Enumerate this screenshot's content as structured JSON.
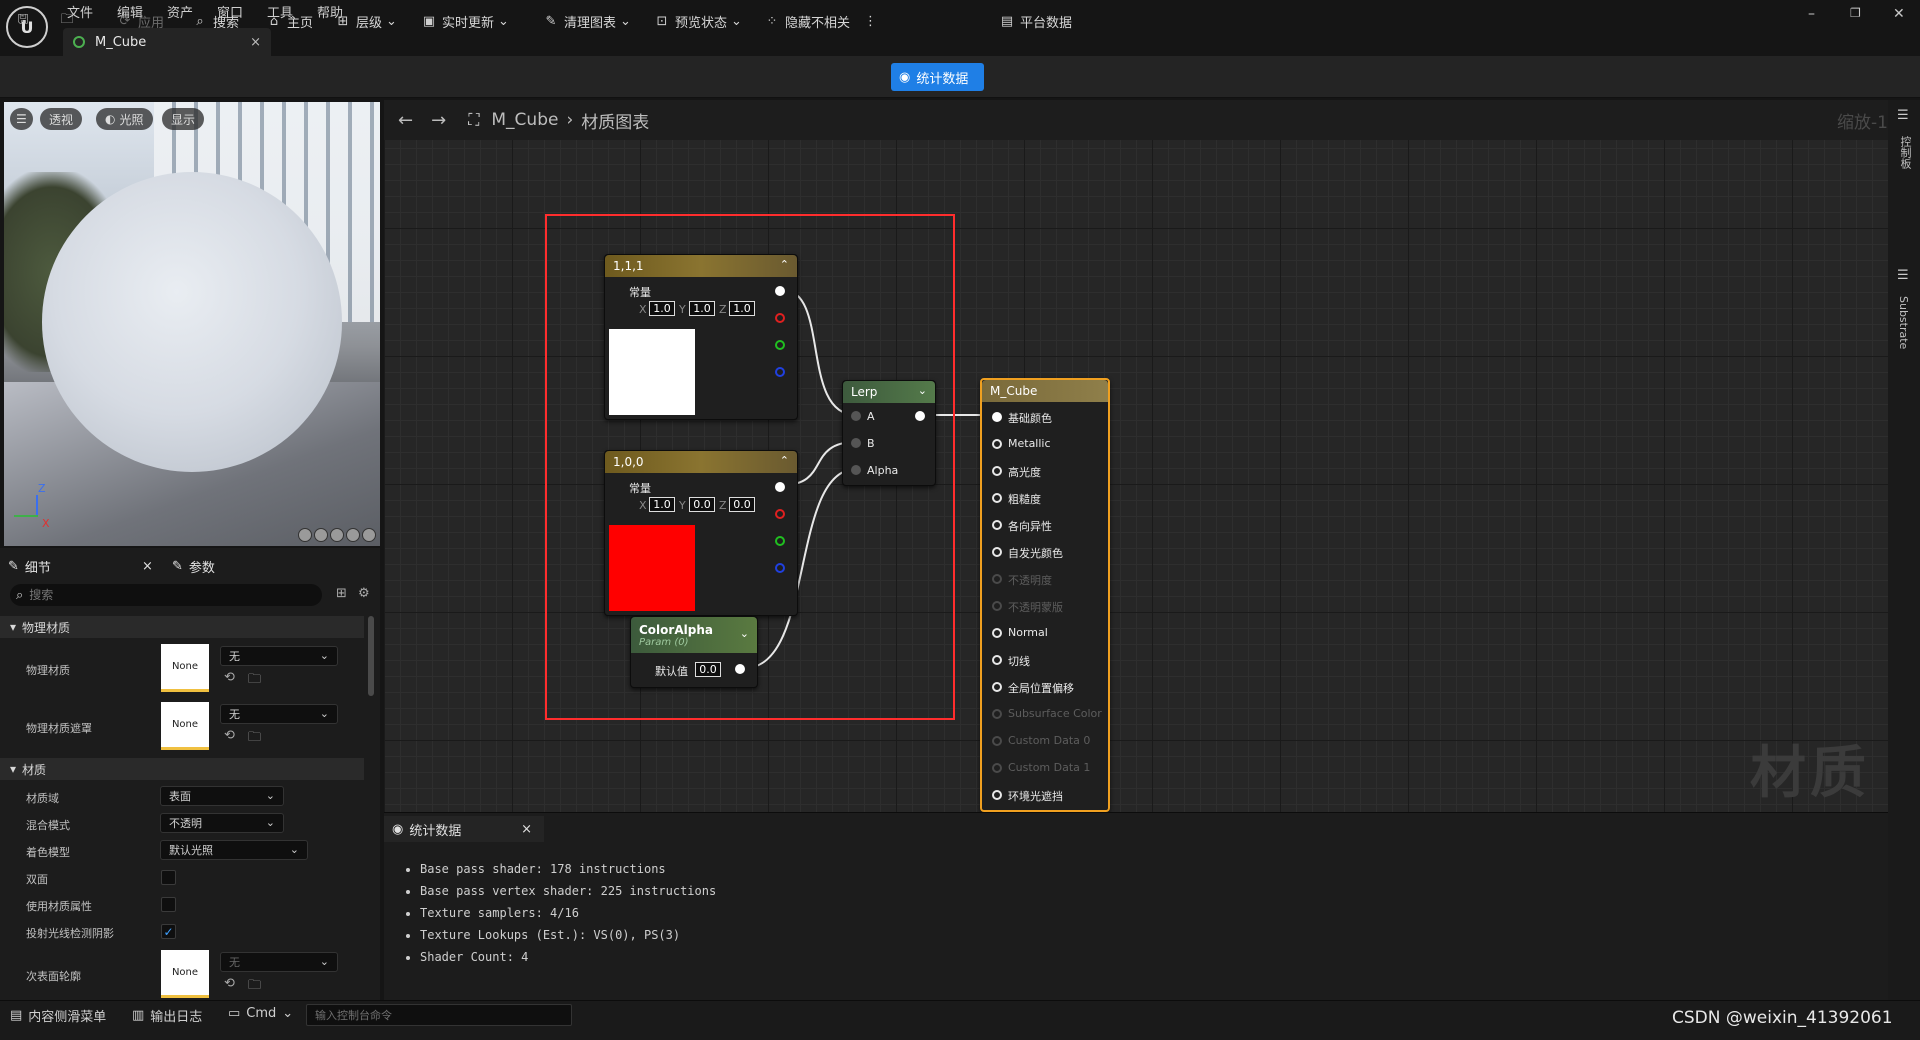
{
  "menu": [
    "文件",
    "编辑",
    "资产",
    "窗口",
    "工具",
    "帮助"
  ],
  "logo_text": "U",
  "document_tab": {
    "label": "M_Cube",
    "close": "×"
  },
  "window_controls": {
    "minimize": "–",
    "restore": "❐",
    "close": "✕"
  },
  "toolbar": {
    "save_icon": "floppy-icon",
    "apply": "应用",
    "search": "搜索",
    "home": "主页",
    "hierarchy": "层级",
    "live_update": "实时更新",
    "clean_graph": "清理图表",
    "preview_state": "预览状态",
    "hide_unrelated": "隐藏不相关",
    "more": "⋮",
    "stats": "统计数据",
    "platform_stats": "平台数据"
  },
  "viewport": {
    "menu_icon": "☰",
    "perspective": "透视",
    "lighting": "光照",
    "show": "显示",
    "axis_z": "Z",
    "axis_x": "X"
  },
  "details_panel": {
    "tab_details": "细节",
    "tab_close": "×",
    "tab_params": "参数",
    "search_placeholder": "搜索",
    "category_physical": "物理材质",
    "physical_material_label": "物理材质",
    "physical_material_value": "无",
    "physical_material_swatch": "None",
    "physical_mask_label": "物理材质遮罩",
    "physical_mask_value": "无",
    "physical_mask_swatch": "None",
    "category_material": "材质",
    "material_domain_label": "材质域",
    "material_domain_value": "表面",
    "blend_mode_label": "混合模式",
    "blend_mode_value": "不透明",
    "shading_model_label": "着色模型",
    "shading_model_value": "默认光照",
    "two_sided_label": "双面",
    "two_sided_checked": false,
    "use_material_attributes_label": "使用材质属性",
    "use_material_attributes_checked": false,
    "cast_ray_traced_shadows_label": "投射光线检测阴影",
    "cast_ray_traced_shadows_checked": true,
    "subsurface_profile_label": "次表面轮廓",
    "subsurface_profile_value": "无",
    "subsurface_profile_swatch": "None"
  },
  "graph": {
    "breadcrumb_asset": "M_Cube",
    "breadcrumb_sep": "›",
    "breadcrumb_graph": "材质图表",
    "zoom": "缩放-1",
    "watermark": "材质",
    "right_tab_1": "控制板",
    "right_tab_2": "Substrate",
    "nodes": {
      "const_white": {
        "title": "1,1,1",
        "subtitle": "常量",
        "x_label": "X",
        "x": "1.0",
        "y_label": "Y",
        "y": "1.0",
        "z_label": "Z",
        "z": "1.0",
        "color": "#ffffff"
      },
      "const_red": {
        "title": "1,0,0",
        "subtitle": "常量",
        "x_label": "X",
        "x": "1.0",
        "y_label": "Y",
        "y": "0.0",
        "z_label": "Z",
        "z": "0.0",
        "color": "#ff0000"
      },
      "color_alpha": {
        "title": "ColorAlpha",
        "subtitle": "Param (0)",
        "default_label": "默认值",
        "default_value": "0.0"
      },
      "lerp": {
        "title": "Lerp",
        "pin_a": "A",
        "pin_b": "B",
        "pin_alpha": "Alpha"
      },
      "material": {
        "title": "M_Cube",
        "pins": [
          {
            "label": "基础颜色",
            "enabled": true
          },
          {
            "label": "Metallic",
            "enabled": true
          },
          {
            "label": "高光度",
            "enabled": true
          },
          {
            "label": "粗糙度",
            "enabled": true
          },
          {
            "label": "各向异性",
            "enabled": true
          },
          {
            "label": "自发光颜色",
            "enabled": true
          },
          {
            "label": "不透明度",
            "enabled": false
          },
          {
            "label": "不透明蒙版",
            "enabled": false
          },
          {
            "label": "Normal",
            "enabled": true
          },
          {
            "label": "切线",
            "enabled": true
          },
          {
            "label": "全局位置偏移",
            "enabled": true
          },
          {
            "label": "Subsurface Color",
            "enabled": false
          },
          {
            "label": "Custom Data 0",
            "enabled": false
          },
          {
            "label": "Custom Data 1",
            "enabled": false
          },
          {
            "label": "环境光遮挡",
            "enabled": true
          }
        ]
      }
    }
  },
  "stats_panel": {
    "tab": "统计数据",
    "close": "×",
    "lines": [
      "Base pass shader: 178 instructions",
      "Base pass vertex shader: 225 instructions",
      "Texture samplers: 4/16",
      "Texture Lookups (Est.): VS(0), PS(3)",
      "Shader Count: 4"
    ]
  },
  "statusbar": {
    "content_drawer": "内容侧滑菜单",
    "output_log": "输出日志",
    "cmd": "Cmd",
    "console_placeholder": "输入控制台命令",
    "watermark": "CSDN @weixin_41392061"
  }
}
